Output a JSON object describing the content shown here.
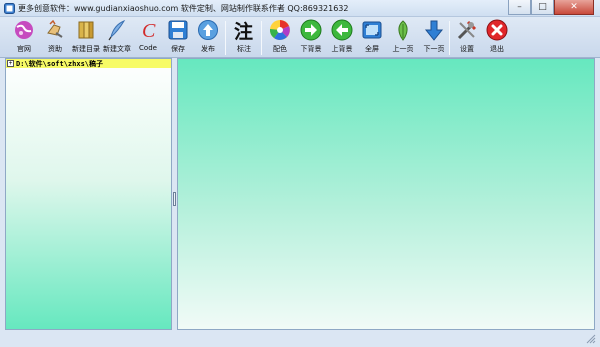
{
  "window": {
    "title": "更多创意软件：www.gudianxiaoshuo.com   软件定制、网站制作联系作者 QQ:869321632",
    "minimize_glyph": "–",
    "maximize_glyph": "□",
    "close_glyph": "✕"
  },
  "toolbar": {
    "items": [
      {
        "label": "官网",
        "icon": "globe-icon"
      },
      {
        "label": "资助",
        "icon": "gift-icon"
      },
      {
        "label": "新建目录",
        "icon": "books-icon"
      },
      {
        "label": "新建文章",
        "icon": "quill-icon"
      },
      {
        "label": "Code",
        "icon": "code-c-icon"
      },
      {
        "label": "保存",
        "icon": "floppy-disk-icon"
      },
      {
        "label": "发布",
        "icon": "upload-arrow-icon"
      },
      {
        "label": "标注",
        "icon": "annotate-char-icon",
        "glyph": "注"
      },
      {
        "label": "配色",
        "icon": "color-wheel-icon"
      },
      {
        "label": "下背景",
        "icon": "arrow-right-circle-icon"
      },
      {
        "label": "上背景",
        "icon": "arrow-left-circle-icon"
      },
      {
        "label": "全屏",
        "icon": "fullscreen-icon"
      },
      {
        "label": "上一页",
        "icon": "leaf-up-icon"
      },
      {
        "label": "下一页",
        "icon": "arrow-down-icon"
      },
      {
        "label": "设置",
        "icon": "tools-icon"
      },
      {
        "label": "退出",
        "icon": "exit-x-icon"
      }
    ]
  },
  "tree": {
    "expander": "+",
    "root_path": "D:\\软件\\soft\\zhxs\\稿子"
  },
  "colors": {
    "tree_highlight": "#f7fb66",
    "pane_green": "#66e8bf"
  }
}
